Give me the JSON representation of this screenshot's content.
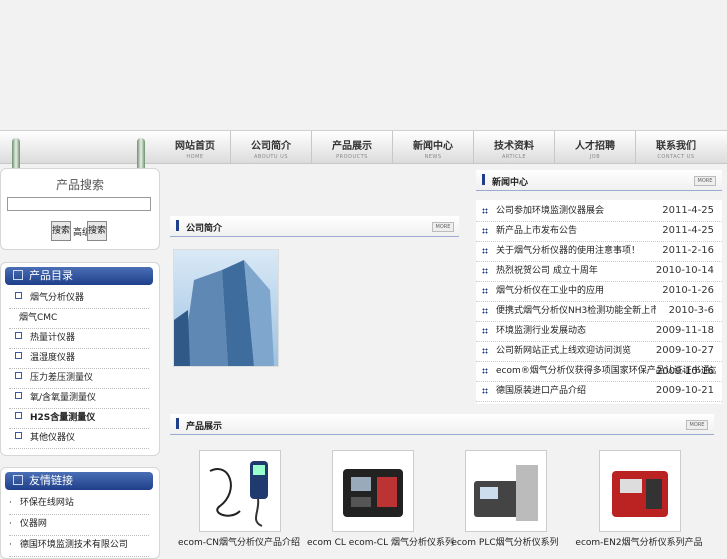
{
  "nav": [
    {
      "cn": "网站首页",
      "en": "HOME"
    },
    {
      "cn": "公司简介",
      "en": "ABOUTU US"
    },
    {
      "cn": "产品展示",
      "en": "PRODUCTS"
    },
    {
      "cn": "新闻中心",
      "en": "NEWS"
    },
    {
      "cn": "技术资料",
      "en": "ARTICLE"
    },
    {
      "cn": "人才招聘",
      "en": "JOB"
    },
    {
      "cn": "联系我们",
      "en": "CONTACT US"
    }
  ],
  "search": {
    "title": "产品搜索",
    "btn1": "搜索",
    "mid": "高级",
    "btn2": "搜索"
  },
  "catalog": {
    "title": "产品目录",
    "items": [
      "烟气分析仪器",
      "烟气CMC",
      "热量计仪器",
      "温湿度仪器",
      "压力差压测量仪",
      "氧/含氧量测量仪",
      "H2S含量测量仪",
      "其他仪器仪"
    ]
  },
  "links": {
    "title": "友情链接",
    "items": [
      "环保在线网站",
      "仪器网",
      "德国环境监测技术有限公司"
    ]
  },
  "about": {
    "title": "公司简介",
    "more": "MORE"
  },
  "news": {
    "title": "新闻中心",
    "more": "MORE",
    "items": [
      {
        "t": "公司参加环境监测仪器展会",
        "d": "2011-4-25"
      },
      {
        "t": "新产品上市发布公告",
        "d": "2011-4-25"
      },
      {
        "t": "关于烟气分析仪器的使用注意事项！",
        "d": "2011-2-16"
      },
      {
        "t": "热烈祝贺公司 成立十周年",
        "d": "2010-10-14"
      },
      {
        "t": "烟气分析仪在工业中的应用",
        "d": "2010-1-26"
      },
      {
        "t": "便携式烟气分析仪NH3检测功能全新上市",
        "d": "2010-3-6"
      },
      {
        "t": "环境监测行业发展动态",
        "d": "2009-11-18"
      },
      {
        "t": "公司新网站正式上线欢迎访问浏览",
        "d": "2009-10-27"
      },
      {
        "t": "ecom®烟气分析仪获得多项国家环保产品认证证书通过",
        "d": "2009-10-16"
      },
      {
        "t": "德国原装进口产品介绍",
        "d": "2009-10-21"
      }
    ]
  },
  "products": {
    "title": "产品展示",
    "more": "MORE",
    "items": [
      "ecom-CN烟气分析仪产品介绍",
      "ecom CL ecom-CL 烟气分析仪系列",
      "ecom PLC烟气分析仪系列",
      "ecom-EN2烟气分析仪系列产品"
    ]
  }
}
